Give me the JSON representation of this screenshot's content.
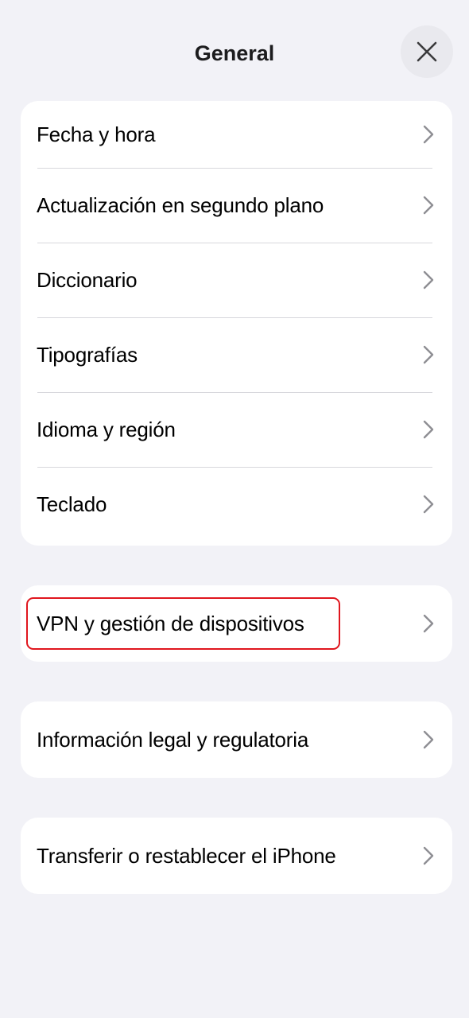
{
  "header": {
    "title": "General",
    "close_icon": "close-icon"
  },
  "groups": [
    {
      "items": [
        {
          "label": "Fecha y hora",
          "icon": "chevron-right-icon"
        },
        {
          "label": "Actualización en segundo plano",
          "icon": "chevron-right-icon"
        },
        {
          "label": "Diccionario",
          "icon": "chevron-right-icon"
        },
        {
          "label": "Tipografías",
          "icon": "chevron-right-icon"
        },
        {
          "label": "Idioma y región",
          "icon": "chevron-right-icon"
        },
        {
          "label": "Teclado",
          "icon": "chevron-right-icon"
        }
      ]
    },
    {
      "items": [
        {
          "label": "VPN y gestión de dispositivos",
          "icon": "chevron-right-icon",
          "highlighted": true
        }
      ]
    },
    {
      "items": [
        {
          "label": "Información legal y regulatoria",
          "icon": "chevron-right-icon"
        }
      ]
    },
    {
      "items": [
        {
          "label": "Transferir o restablecer el iPhone",
          "icon": "chevron-right-icon"
        }
      ]
    }
  ],
  "colors": {
    "background": "#f2f2f7",
    "card": "#ffffff",
    "separator": "#d7d7dc",
    "chevron": "#8e8e93",
    "highlight": "#e0161e"
  }
}
